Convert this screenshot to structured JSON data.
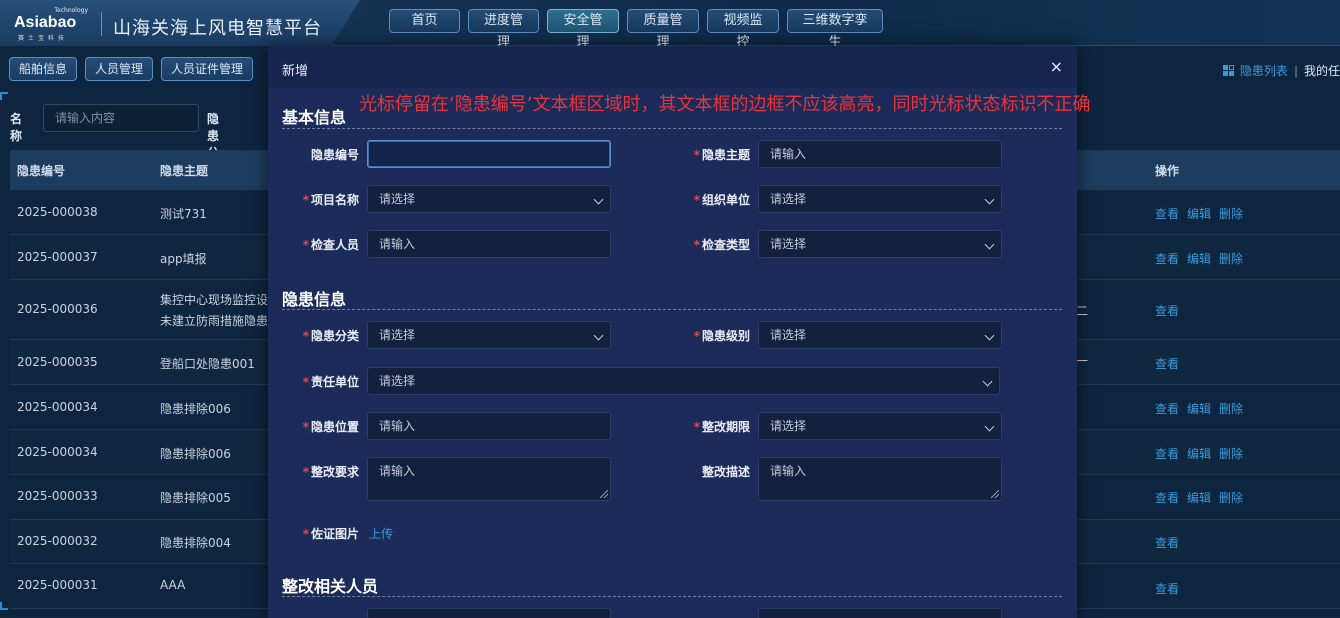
{
  "header": {
    "logo_tech": "Technology",
    "logo_text": "Asiabao",
    "logo_sub": "赛士宝科技",
    "title": "山海关海上风电智慧平台",
    "nav": [
      {
        "label": "首页"
      },
      {
        "label": "进度管理"
      },
      {
        "label": "安全管理"
      },
      {
        "label": "质量管理"
      },
      {
        "label": "视频监控"
      },
      {
        "label": "三维数字孪生"
      }
    ]
  },
  "subbar": {
    "buttons": [
      {
        "label": "船舶信息"
      },
      {
        "label": "人员管理"
      },
      {
        "label": "人员证件管理"
      }
    ],
    "right_active": "隐患列表",
    "right_sep": "|",
    "right_other": "我的任"
  },
  "search": {
    "name_label": "名称",
    "name_placeholder": "请输入内容",
    "category_label": "隐患分类"
  },
  "table": {
    "headers": {
      "id": "隐患编号",
      "topic": "隐患主题",
      "ops": "操作"
    },
    "rows": [
      {
        "id": "2025-000038",
        "topic": "测试731",
        "topic2": "",
        "ops": [
          "查看",
          "编辑",
          "删除"
        ],
        "extra": ""
      },
      {
        "id": "2025-000037",
        "topic": "app填报",
        "topic2": "",
        "ops": [
          "查看",
          "编辑",
          "删除"
        ],
        "extra": ""
      },
      {
        "id": "2025-000036",
        "topic": "集控中心现场监控设",
        "topic2": "未建立防雨措施隐患",
        "ops": [
          "查看"
        ],
        "extra": "二"
      },
      {
        "id": "2025-000035",
        "topic": "登船口处隐患001",
        "topic2": "",
        "ops": [
          "查看"
        ],
        "extra": "一"
      },
      {
        "id": "2025-000034",
        "topic": "隐患排除006",
        "topic2": "",
        "ops": [
          "查看",
          "编辑",
          "删除"
        ],
        "extra": ""
      },
      {
        "id": "2025-000034",
        "topic": "隐患排除006",
        "topic2": "",
        "ops": [
          "查看",
          "编辑",
          "删除"
        ],
        "extra": ""
      },
      {
        "id": "2025-000033",
        "topic": "隐患排除005",
        "topic2": "",
        "ops": [
          "查看",
          "编辑",
          "删除"
        ],
        "extra": ""
      },
      {
        "id": "2025-000032",
        "topic": "隐患排除004",
        "topic2": "",
        "ops": [
          "查看"
        ],
        "extra": ""
      },
      {
        "id": "2025-000031",
        "topic": "AAA",
        "topic2": "",
        "ops": [
          "查看"
        ],
        "extra": ""
      }
    ]
  },
  "modal": {
    "title": "新增",
    "close": "×",
    "sections": {
      "basic": "基本信息",
      "hazard": "隐患信息",
      "people": "整改相关人员"
    },
    "fields": {
      "hazard_no": {
        "label": "隐患编号",
        "value": ""
      },
      "hazard_topic": {
        "label": "隐患主题",
        "placeholder": "请输入"
      },
      "project_name": {
        "label": "项目名称",
        "placeholder": "请选择"
      },
      "org_unit": {
        "label": "组织单位",
        "placeholder": "请选择"
      },
      "inspector": {
        "label": "检查人员",
        "placeholder": "请输入"
      },
      "inspect_type": {
        "label": "检查类型",
        "placeholder": "请选择"
      },
      "hazard_category": {
        "label": "隐患分类",
        "placeholder": "请选择"
      },
      "hazard_level": {
        "label": "隐患级别",
        "placeholder": "请选择"
      },
      "resp_unit": {
        "label": "责任单位",
        "placeholder": "请选择"
      },
      "hazard_location": {
        "label": "隐患位置",
        "placeholder": "请输入"
      },
      "rectify_deadline": {
        "label": "整改期限",
        "placeholder": "请选择"
      },
      "rectify_req": {
        "label": "整改要求",
        "placeholder": "请输入"
      },
      "rectify_desc": {
        "label": "整改描述",
        "placeholder": "请输入"
      },
      "evidence_img": {
        "label": "佐证图片",
        "action": "上传"
      }
    },
    "required_mark": "*"
  },
  "annotation": "光标停留在‘隐患编号’文本框区域时，其文本框的边框不应该高亮，同时光标状态标识不正确",
  "colors": {
    "accent": "#3a9ad9",
    "required": "#e24a4a",
    "annotation": "#e8343a",
    "modal_bg": "#1c2b5a"
  }
}
